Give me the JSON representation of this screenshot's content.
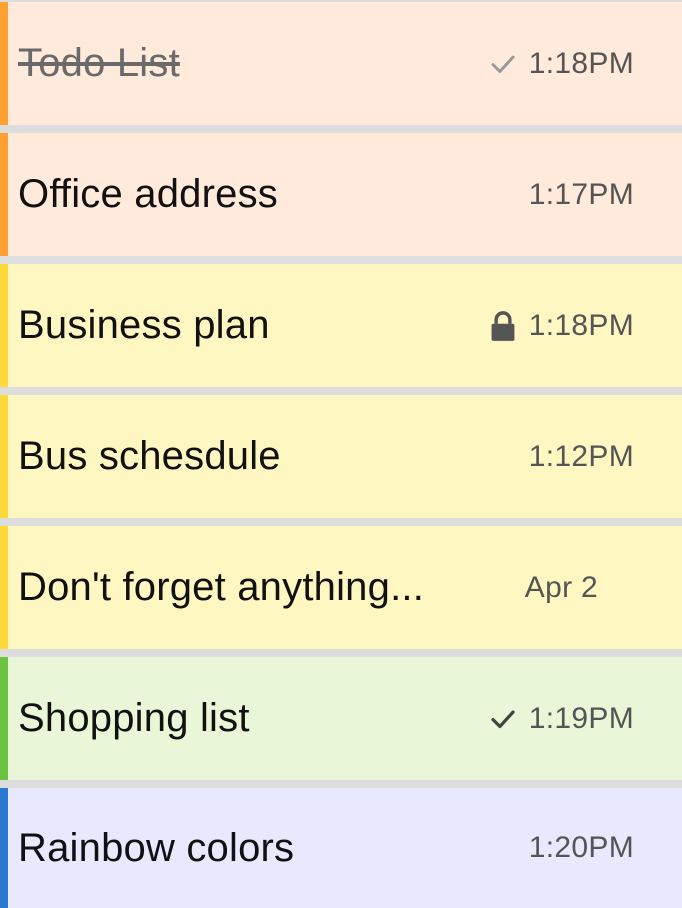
{
  "notes": [
    {
      "title": "Todo List",
      "time": "1:18PM",
      "icon": "check-icon",
      "strikethrough": true,
      "bg": "#ffeadb",
      "accent": "#ffa033",
      "icon_color": "#9a9a9a"
    },
    {
      "title": "Office address",
      "time": "1:17PM",
      "icon": "",
      "strikethrough": false,
      "bg": "#ffeadb",
      "accent": "#ffa033"
    },
    {
      "title": "Business plan",
      "time": "1:18PM",
      "icon": "lock-icon",
      "strikethrough": false,
      "bg": "#fff7c2",
      "accent": "#ffd83a",
      "icon_color": "#555555"
    },
    {
      "title": "Bus schesdule",
      "time": "1:12PM",
      "icon": "",
      "strikethrough": false,
      "bg": "#fff7c2",
      "accent": "#ffd83a"
    },
    {
      "title": "Don't forget anything...",
      "time": "Apr 2",
      "icon": "",
      "strikethrough": false,
      "bg": "#fff7c2",
      "accent": "#ffd83a"
    },
    {
      "title": "Shopping list",
      "time": "1:19PM",
      "icon": "check-icon",
      "strikethrough": false,
      "bg": "#e9f7d8",
      "accent": "#6cc241",
      "icon_color": "#444444"
    },
    {
      "title": "Rainbow colors",
      "time": "1:20PM",
      "icon": "",
      "strikethrough": false,
      "bg": "#e8e8ff",
      "accent": "#2b78d3"
    }
  ]
}
